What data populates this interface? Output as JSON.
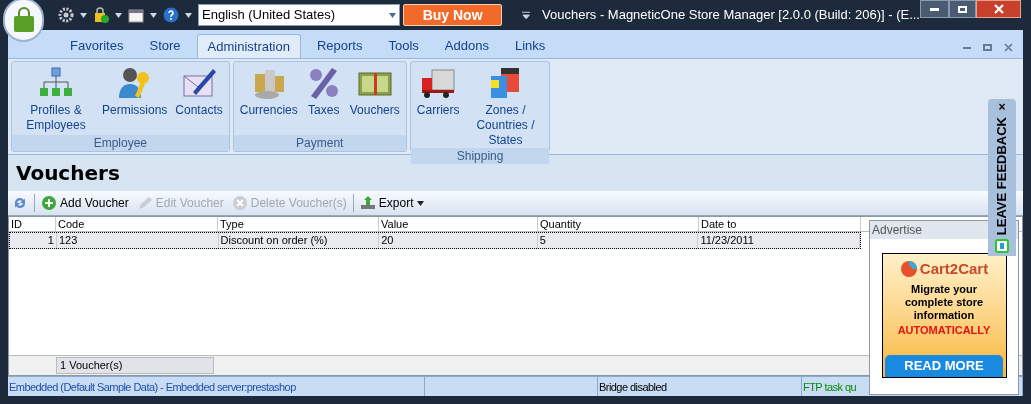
{
  "window": {
    "title": "Vouchers - MagneticOne Store Manager [2.0.0 (Build: 206)] - (E...",
    "language": "English (United States)",
    "buy_button": "Buy Now"
  },
  "ribbon_tabs": [
    {
      "label": "Favorites",
      "selected": false
    },
    {
      "label": "Store",
      "selected": false
    },
    {
      "label": "Administration",
      "selected": true
    },
    {
      "label": "Reports",
      "selected": false
    },
    {
      "label": "Tools",
      "selected": false
    },
    {
      "label": "Addons",
      "selected": false
    },
    {
      "label": "Links",
      "selected": false
    }
  ],
  "ribbon_groups": [
    {
      "label": "Employee",
      "items": [
        {
          "label": "Profiles & Employees",
          "kind": "org"
        },
        {
          "label": "Permissions",
          "kind": "user-key"
        },
        {
          "label": "Contacts",
          "kind": "mail"
        }
      ]
    },
    {
      "label": "Payment",
      "items": [
        {
          "label": "Currencies",
          "kind": "coins"
        },
        {
          "label": "Taxes",
          "kind": "percent"
        },
        {
          "label": "Vouchers",
          "kind": "banknote"
        }
      ]
    },
    {
      "label": "Shipping",
      "items": [
        {
          "label": "Carriers",
          "kind": "truck"
        },
        {
          "label": "Zones / Countries / States",
          "kind": "flags"
        }
      ]
    }
  ],
  "page_title": "Vouchers",
  "toolbar": [
    {
      "kind": "refresh",
      "disabled": false
    },
    {
      "kind": "add",
      "label": "Add Voucher",
      "disabled": false
    },
    {
      "kind": "edit",
      "label": "Edit Voucher",
      "disabled": true
    },
    {
      "kind": "delete",
      "label": "Delete Voucher(s)",
      "disabled": true
    },
    {
      "kind": "export",
      "label": "Export",
      "disabled": false
    }
  ],
  "table": {
    "columns": [
      "ID",
      "Code",
      "Type",
      "Value",
      "Quantity",
      "Date to"
    ],
    "rows": [
      {
        "cells": [
          "1",
          "123",
          "Discount on order (%)",
          "20",
          "5",
          "11/23/2011"
        ],
        "selected": true
      }
    ]
  },
  "footer": {
    "count": "1 Voucher(s)"
  },
  "advertise": {
    "title": "Advertise",
    "brand": "Cart2Cart",
    "text": "Migrate your complete store information",
    "highlight": "AUTOMATICALLY",
    "button": "READ MORE"
  },
  "feedback": {
    "label": "LEAVE FEEDBACK",
    "close": "×"
  },
  "status_bar": [
    {
      "text": "Embedded (Default Sample Data) - Embedded server:prestashop",
      "color": "#1f4fa8"
    },
    {
      "text": "Bridge disabled",
      "color": "#000000"
    },
    {
      "text": "FTP task qu",
      "color": "#0a8a0a"
    }
  ]
}
